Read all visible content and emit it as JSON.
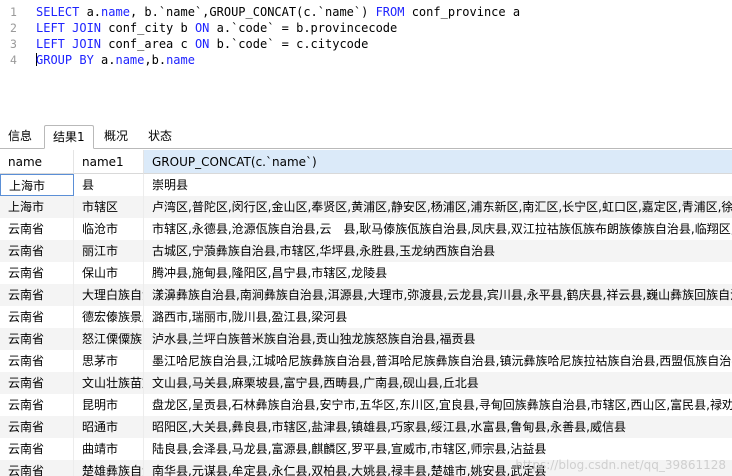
{
  "editor": {
    "lines": [
      {
        "n": "1",
        "parts": [
          {
            "t": "SELECT ",
            "k": "kw"
          },
          {
            "t": "a.",
            "k": ""
          },
          {
            "t": "name",
            "k": "kw"
          },
          {
            "t": ", b.`name`,GROUP_CONCAT(c.`name`) ",
            "k": ""
          },
          {
            "t": "FROM",
            "k": "kw"
          },
          {
            "t": " conf_province a",
            "k": ""
          }
        ]
      },
      {
        "n": "2",
        "parts": [
          {
            "t": "LEFT JOIN",
            "k": "kw"
          },
          {
            "t": " conf_city b ",
            "k": ""
          },
          {
            "t": "ON",
            "k": "kw"
          },
          {
            "t": " a.`code` = b.provincecode",
            "k": ""
          }
        ]
      },
      {
        "n": "3",
        "parts": [
          {
            "t": "LEFT JOIN",
            "k": "kw"
          },
          {
            "t": " conf_area c ",
            "k": ""
          },
          {
            "t": "ON",
            "k": "kw"
          },
          {
            "t": " b.`code` = c.citycode",
            "k": ""
          }
        ]
      },
      {
        "n": "4",
        "parts": [
          {
            "t": "GROUP BY",
            "k": "kw"
          },
          {
            "t": " a.",
            "k": ""
          },
          {
            "t": "name",
            "k": "kw"
          },
          {
            "t": ",b.",
            "k": ""
          },
          {
            "t": "name",
            "k": "kw"
          }
        ]
      }
    ]
  },
  "tabs": [
    "信息",
    "结果1",
    "概况",
    "状态"
  ],
  "active_tab": 1,
  "columns": [
    "name",
    "name1",
    "GROUP_CONCAT(c.`name`)"
  ],
  "rows": [
    [
      "上海市",
      "县",
      "崇明县"
    ],
    [
      "上海市",
      "市辖区",
      "卢湾区,普陀区,闵行区,金山区,奉贤区,黄浦区,静安区,杨浦区,浦东新区,南汇区,长宁区,虹口区,嘉定区,青浦区,徐汇区"
    ],
    [
      "云南省",
      "临沧市",
      "市辖区,永德县,沧源佤族自治县,云　县,耿马傣族佤族自治县,凤庆县,双江拉祜族佤族布朗族傣族自治县,临翔区,镇康县"
    ],
    [
      "云南省",
      "丽江市",
      "古城区,宁蒗彝族自治县,市辖区,华坪县,永胜县,玉龙纳西族自治县"
    ],
    [
      "云南省",
      "保山市",
      "腾冲县,施甸县,隆阳区,昌宁县,市辖区,龙陵县"
    ],
    [
      "云南省",
      "大理白族自治州",
      "漾濞彝族自治县,南涧彝族自治县,洱源县,大理市,弥渡县,云龙县,宾川县,永平县,鹤庆县,祥云县,巍山彝族回族自治县"
    ],
    [
      "云南省",
      "德宏傣族景颇族自治州",
      "潞西市,瑞丽市,陇川县,盈江县,梁河县"
    ],
    [
      "云南省",
      "怒江傈僳族自治州",
      "泸水县,兰坪白族普米族自治县,贡山独龙族怒族自治县,福贡县"
    ],
    [
      "云南省",
      "思茅市",
      "墨江哈尼族自治县,江城哈尼族彝族自治县,普洱哈尼族彝族自治县,镇沅彝族哈尼族拉祜族自治县,西盟佤族自治县"
    ],
    [
      "云南省",
      "文山壮族苗族自治州",
      "文山县,马关县,麻栗坡县,富宁县,西畴县,广南县,砚山县,丘北县"
    ],
    [
      "云南省",
      "昆明市",
      "盘龙区,呈贡县,石林彝族自治县,安宁市,五华区,东川区,宜良县,寻甸回族彝族自治县,市辖区,西山区,富民县,禄劝彝族苗族自治县"
    ],
    [
      "云南省",
      "昭通市",
      "昭阳区,大关县,彝良县,市辖区,盐津县,镇雄县,巧家县,绥江县,水富县,鲁甸县,永善县,威信县"
    ],
    [
      "云南省",
      "曲靖市",
      "陆良县,会泽县,马龙县,富源县,麒麟区,罗平县,宣威市,市辖区,师宗县,沾益县"
    ],
    [
      "云南省",
      "楚雄彝族自治州",
      "南华县,元谋县,牟定县,永仁县,双柏县,大姚县,禄丰县,楚雄市,姚安县,武定县"
    ]
  ],
  "watermark": "https://blog.csdn.net/qq_39861128"
}
